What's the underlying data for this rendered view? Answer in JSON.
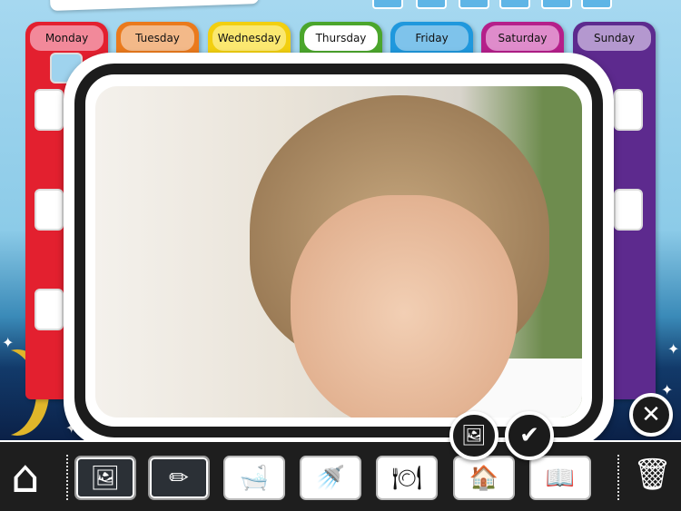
{
  "days": [
    {
      "label": "Monday",
      "color": "#e3202f",
      "tab": "#f2899a"
    },
    {
      "label": "Tuesday",
      "color": "#ea7a1d",
      "tab": "#f3b989"
    },
    {
      "label": "Wednesday",
      "color": "#f2cf10",
      "tab": "#fbe870"
    },
    {
      "label": "Thursday",
      "color": "#4ba62c",
      "tab": "#ffffff"
    },
    {
      "label": "Friday",
      "color": "#1f98dd",
      "tab": "#7ec3eb"
    },
    {
      "label": "Saturday",
      "color": "#b51f8a",
      "tab": "#df8ccb"
    },
    {
      "label": "Sunday",
      "color": "#5d2a8e",
      "tab": "#b498cf"
    }
  ],
  "toolbar": {
    "items": [
      {
        "name": "photo-library",
        "icon": "🖼",
        "style": "dark"
      },
      {
        "name": "pencil",
        "icon": "✏",
        "style": "dark"
      },
      {
        "name": "bathtub",
        "icon": "🛁",
        "style": "light"
      },
      {
        "name": "shower",
        "icon": "🚿",
        "style": "light"
      },
      {
        "name": "meal",
        "icon": "🍽",
        "style": "light"
      },
      {
        "name": "house",
        "icon": "🏠",
        "style": "light"
      },
      {
        "name": "book",
        "icon": "📖",
        "style": "light"
      }
    ],
    "home_icon": "⌂",
    "trash_icon": "🗑"
  },
  "modal": {
    "photo_icon": "🖼",
    "confirm_icon": "✔",
    "close_icon": "✕"
  }
}
